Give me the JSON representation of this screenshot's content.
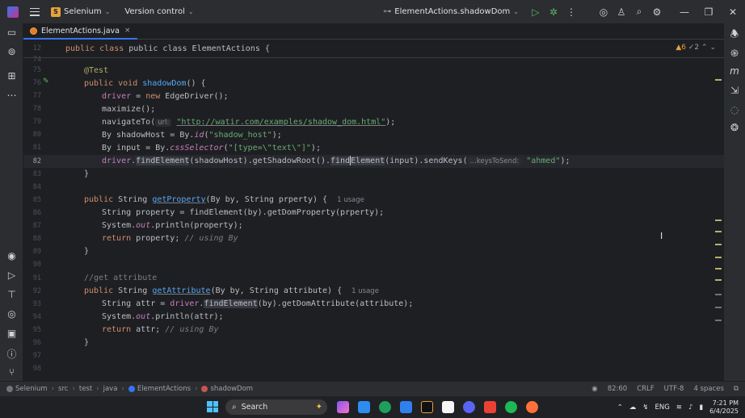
{
  "titlebar": {
    "project_badge": "S",
    "project_name": "Selenium",
    "vcs_label": "Version control",
    "run_config": "ElementActions.shadowDom",
    "icons": [
      "menu-icon",
      "run-icon",
      "debug-icon",
      "more-icon",
      "ai-icon",
      "add-user-icon",
      "search-icon",
      "settings-icon",
      "minimize-icon",
      "restore-icon",
      "close-icon"
    ]
  },
  "tab": {
    "label": "ElementActions.java",
    "close": "×"
  },
  "sticky": {
    "line_no": "12",
    "code": "public class ElementActions {"
  },
  "inspections": {
    "warnings": "▲6",
    "checks": "✓2",
    "nav": "⌃ ⌄"
  },
  "editor": {
    "lines": [
      {
        "no": "74"
      },
      {
        "no": "75"
      },
      {
        "no": "76"
      },
      {
        "no": "77"
      },
      {
        "no": "78"
      },
      {
        "no": "79"
      },
      {
        "no": "80"
      },
      {
        "no": "81"
      },
      {
        "no": "82"
      },
      {
        "no": "83"
      },
      {
        "no": "84"
      },
      {
        "no": "85"
      },
      {
        "no": "86"
      },
      {
        "no": "87"
      },
      {
        "no": "88"
      },
      {
        "no": "89"
      },
      {
        "no": "90"
      },
      {
        "no": "91"
      },
      {
        "no": "92"
      },
      {
        "no": "93"
      },
      {
        "no": "94"
      },
      {
        "no": "95"
      },
      {
        "no": "96"
      },
      {
        "no": "97"
      },
      {
        "no": "98"
      }
    ],
    "code": {
      "l75": "@Test",
      "l76_kw": "public void ",
      "l76_fn": "shadowDom",
      "l76_rest": "() {",
      "l77_fld": "driver",
      "l77_mid": " = ",
      "l77_kw": "new ",
      "l77_rest": "EdgeDriver();",
      "l78": "maximize();",
      "l79_a": "navigateTo(",
      "l79_hint": "url:",
      "l79_str": "\"http://watir.com/examples/shadow_dom.html\"",
      "l79_rest": ");",
      "l80_a": "By shadowHost = By.",
      "l80_st": "id",
      "l80_b": "(",
      "l80_str": "\"shadow_host\"",
      "l80_rest": ");",
      "l81_a": "By input = By.",
      "l81_st": "cssSelector",
      "l81_b": "(",
      "l81_str": "\"[type=\\\"text\\\"]\"",
      "l81_rest": ");",
      "l82_fld": "driver",
      "l82_a": ".",
      "l82_hl1": "findElement",
      "l82_b": "(shadowHost).getShadowRoot().",
      "l82_hl2a": "find",
      "l82_hl2b": "Element",
      "l82_c": "(input).sendKeys(",
      "l82_hint": "...keysToSend:",
      "l82_str": "\"ahmed\"",
      "l82_rest": ");",
      "l83": "}",
      "l85_kw": "public ",
      "l85_a": "String ",
      "l85_fn": "getProperty",
      "l85_b": "(By by, String prperty) {",
      "l85_usage": "1 usage",
      "l86_a": "String property = findElement(by).getDomProperty(prperty);",
      "l87_a": "System.",
      "l87_st": "out",
      "l87_b": ".println(property);",
      "l88_kw": "return ",
      "l88_a": "property; ",
      "l88_cm": "// using By",
      "l89": "}",
      "l91_cm": "//get attribute",
      "l92_kw": "public ",
      "l92_a": "String ",
      "l92_fn": "getAttribute",
      "l92_b": "(By by, String attribute) {",
      "l92_usage": "1 usage",
      "l93_a": "String attr = ",
      "l93_fld": "driver",
      "l93_b": ".",
      "l93_hl": "findElement",
      "l93_c": "(by).getDomAttribute(attribute);",
      "l94_a": "System.",
      "l94_st": "out",
      "l94_b": ".println(attr);",
      "l95_kw": "return ",
      "l95_a": "attr; ",
      "l95_cm": "// using By",
      "l96": "}"
    }
  },
  "statusbar": {
    "breadcrumbs": [
      "Selenium",
      "src",
      "test",
      "java",
      "ElementActions",
      "shadowDom"
    ],
    "position": "82:60",
    "line_sep": "CRLF",
    "encoding": "UTF-8",
    "indent": "4 spaces"
  },
  "taskbar": {
    "search": "Search",
    "lang": "ENG",
    "time": "7:21 PM",
    "date": "6/4/2025"
  },
  "colors": {
    "editor_bg": "#1e1f22",
    "chrome_bg": "#2b2d30",
    "keyword": "#cf8e6d",
    "string": "#6aab73",
    "function": "#56a8f5",
    "field": "#c77dbb",
    "accent": "#3574f0"
  }
}
